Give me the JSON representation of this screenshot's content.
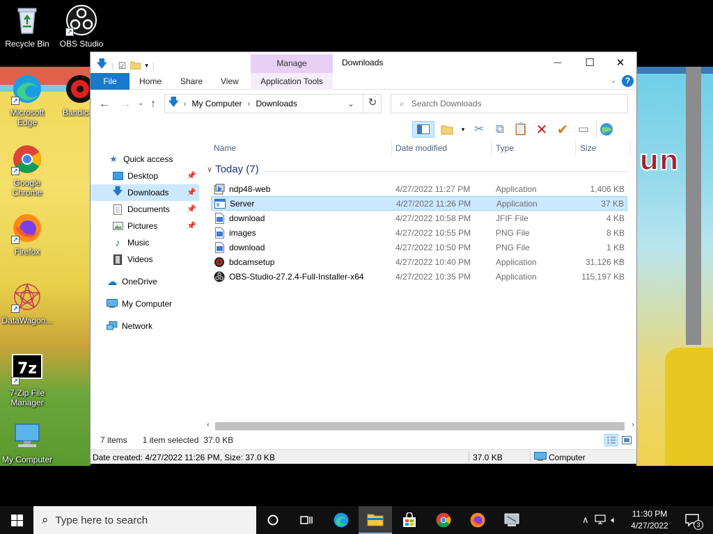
{
  "desktop": {
    "wallpaper_text": "un",
    "icons": [
      {
        "label": "Recycle Bin"
      },
      {
        "label": "OBS Studio"
      },
      {
        "label": "Microsoft Edge"
      },
      {
        "label": "Bandica"
      },
      {
        "label": "Google Chrome"
      },
      {
        "label": "Firefox"
      },
      {
        "label": "DataWagon..."
      },
      {
        "label": "7-Zip File Manager"
      },
      {
        "label": "My Computer"
      }
    ]
  },
  "window": {
    "title": "Downloads",
    "manage_tab": "Manage",
    "ribbon_tabs": [
      "File",
      "Home",
      "Share",
      "View",
      "Application Tools"
    ],
    "controls": {
      "minimize": "—",
      "maximize": "☐",
      "close": "✕"
    },
    "help": "?",
    "address": {
      "breadcrumb": [
        "My Computer",
        "Downloads"
      ]
    },
    "search": {
      "placeholder": "Search Downloads"
    },
    "nav": {
      "quick_access": "Quick access",
      "items": [
        {
          "label": "Desktop",
          "pinned": true
        },
        {
          "label": "Downloads",
          "pinned": true,
          "selected": true
        },
        {
          "label": "Documents",
          "pinned": true
        },
        {
          "label": "Pictures",
          "pinned": true
        },
        {
          "label": "Music",
          "pinned": false
        },
        {
          "label": "Videos",
          "pinned": false
        }
      ],
      "onedrive": "OneDrive",
      "my_computer": "My Computer",
      "network": "Network"
    },
    "columns": [
      "Name",
      "Date modified",
      "Type",
      "Size"
    ],
    "group": "Today (7)",
    "files": [
      {
        "name": "ndp48-web",
        "date": "4/27/2022 11:27 PM",
        "type": "Application",
        "size": "1,406 KB",
        "icon": "installer-icon"
      },
      {
        "name": "Server",
        "date": "4/27/2022 11:26 PM",
        "type": "Application",
        "size": "37 KB",
        "icon": "app-window-icon",
        "selected": true
      },
      {
        "name": "download",
        "date": "4/27/2022 10:58 PM",
        "type": "JFIF File",
        "size": "4 KB",
        "icon": "image-file-icon"
      },
      {
        "name": "images",
        "date": "4/27/2022 10:55 PM",
        "type": "PNG File",
        "size": "8 KB",
        "icon": "image-file-icon"
      },
      {
        "name": "download",
        "date": "4/27/2022 10:50 PM",
        "type": "PNG File",
        "size": "1 KB",
        "icon": "image-file-icon"
      },
      {
        "name": "bdcamsetup",
        "date": "4/27/2022 10:40 PM",
        "type": "Application",
        "size": "31,126 KB",
        "icon": "bandicam-icon"
      },
      {
        "name": "OBS-Studio-27.2.4-Full-Installer-x64",
        "date": "4/27/2022 10:35 PM",
        "type": "Application",
        "size": "115,197 KB",
        "icon": "obs-icon"
      }
    ],
    "status": {
      "items": "7 items",
      "selected": "1 item selected",
      "selected_size": "37.0 KB"
    },
    "infobar": {
      "details": "Date created: 4/27/2022 11:26 PM, Size: 37.0 KB",
      "size": "37.0 KB",
      "location": "Computer"
    }
  },
  "taskbar": {
    "search_placeholder": "Type here to search",
    "time": "11:30 PM",
    "date": "4/27/2022",
    "notification_count": "3"
  },
  "colors": {
    "accent": "#1979ca",
    "selection": "#cce8ff",
    "manage_tab": "#e8d0f4",
    "group_header": "#1e3287"
  }
}
